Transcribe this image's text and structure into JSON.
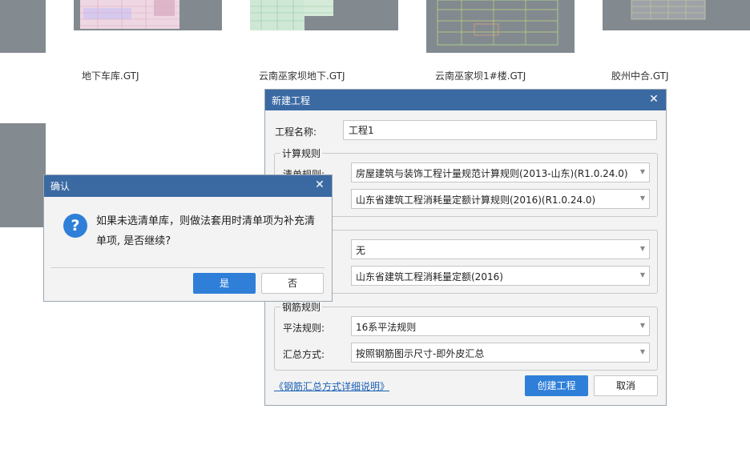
{
  "file_browser": {
    "files": [
      {
        "name": "地下车库.GTJ"
      },
      {
        "name": "云南巫家坝地下.GTJ"
      },
      {
        "name": "云南巫家坝1#楼.GTJ"
      },
      {
        "name": "胶州中合.GTJ"
      }
    ]
  },
  "new_project_dialog": {
    "title": "新建工程",
    "project_name_label": "工程名称:",
    "project_name_value": "工程1",
    "calc_rules": {
      "legend": "计算规则",
      "list_rule_label": "清单规则:",
      "list_rule_value": "房屋建筑与装饰工程计量规范计算规则(2013-山东)(R1.0.24.0)",
      "quota_rule_value": "山东省建筑工程消耗量定额计算规则(2016)(R1.0.24.0)"
    },
    "library": {
      "list_library_value": "无",
      "quota_library_value": "山东省建筑工程消耗量定额(2016)"
    },
    "rebar": {
      "legend": "钢筋规则",
      "flat_rule_label": "平法规则:",
      "flat_rule_value": "16系平法规则",
      "summary_label": "汇总方式:",
      "summary_value": "按照钢筋图示尺寸-即外皮汇总"
    },
    "help_link": "《钢筋汇总方式详细说明》",
    "create_button": "创建工程",
    "cancel_button": "取消"
  },
  "confirm_dialog": {
    "title": "确认",
    "message": "如果未选清单库，则做法套用时清单项为补充清单项, 是否继续?",
    "yes_button": "是",
    "no_button": "否"
  },
  "colors": {
    "title_bar": "#3b6aa3",
    "primary_button": "#2f7fd8",
    "link": "#1a5fb4",
    "thumbnail_bg": "#838a90"
  }
}
